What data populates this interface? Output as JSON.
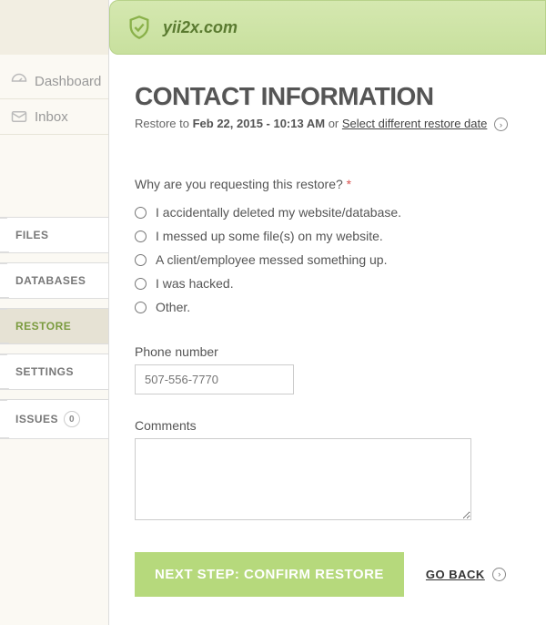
{
  "header": {
    "site_name": "yii2x.com"
  },
  "nav_primary": {
    "dashboard": "Dashboard",
    "inbox": "Inbox"
  },
  "tabs": {
    "files": "FILES",
    "databases": "DATABASES",
    "restore": "RESTORE",
    "settings": "SETTINGS",
    "issues": "ISSUES",
    "issues_count": "0"
  },
  "main": {
    "title": "CONTACT INFORMATION",
    "restore_prefix": "Restore to ",
    "restore_date": "Feb 22, 2015 - 10:13 AM",
    "restore_or": " or  ",
    "select_different": "Select different restore date",
    "reason_label": "Why are you requesting this restore? ",
    "reason_required": "*",
    "options": {
      "o1": "I accidentally deleted my website/database.",
      "o2": "I messed up some file(s) on my website.",
      "o3": "A client/employee messed something up.",
      "o4": "I was hacked.",
      "o5": "Other."
    },
    "phone_label": "Phone number",
    "phone_placeholder": "507-556-7770",
    "comments_label": "Comments",
    "next_button": "NEXT STEP: CONFIRM RESTORE",
    "go_back": "GO BACK"
  }
}
